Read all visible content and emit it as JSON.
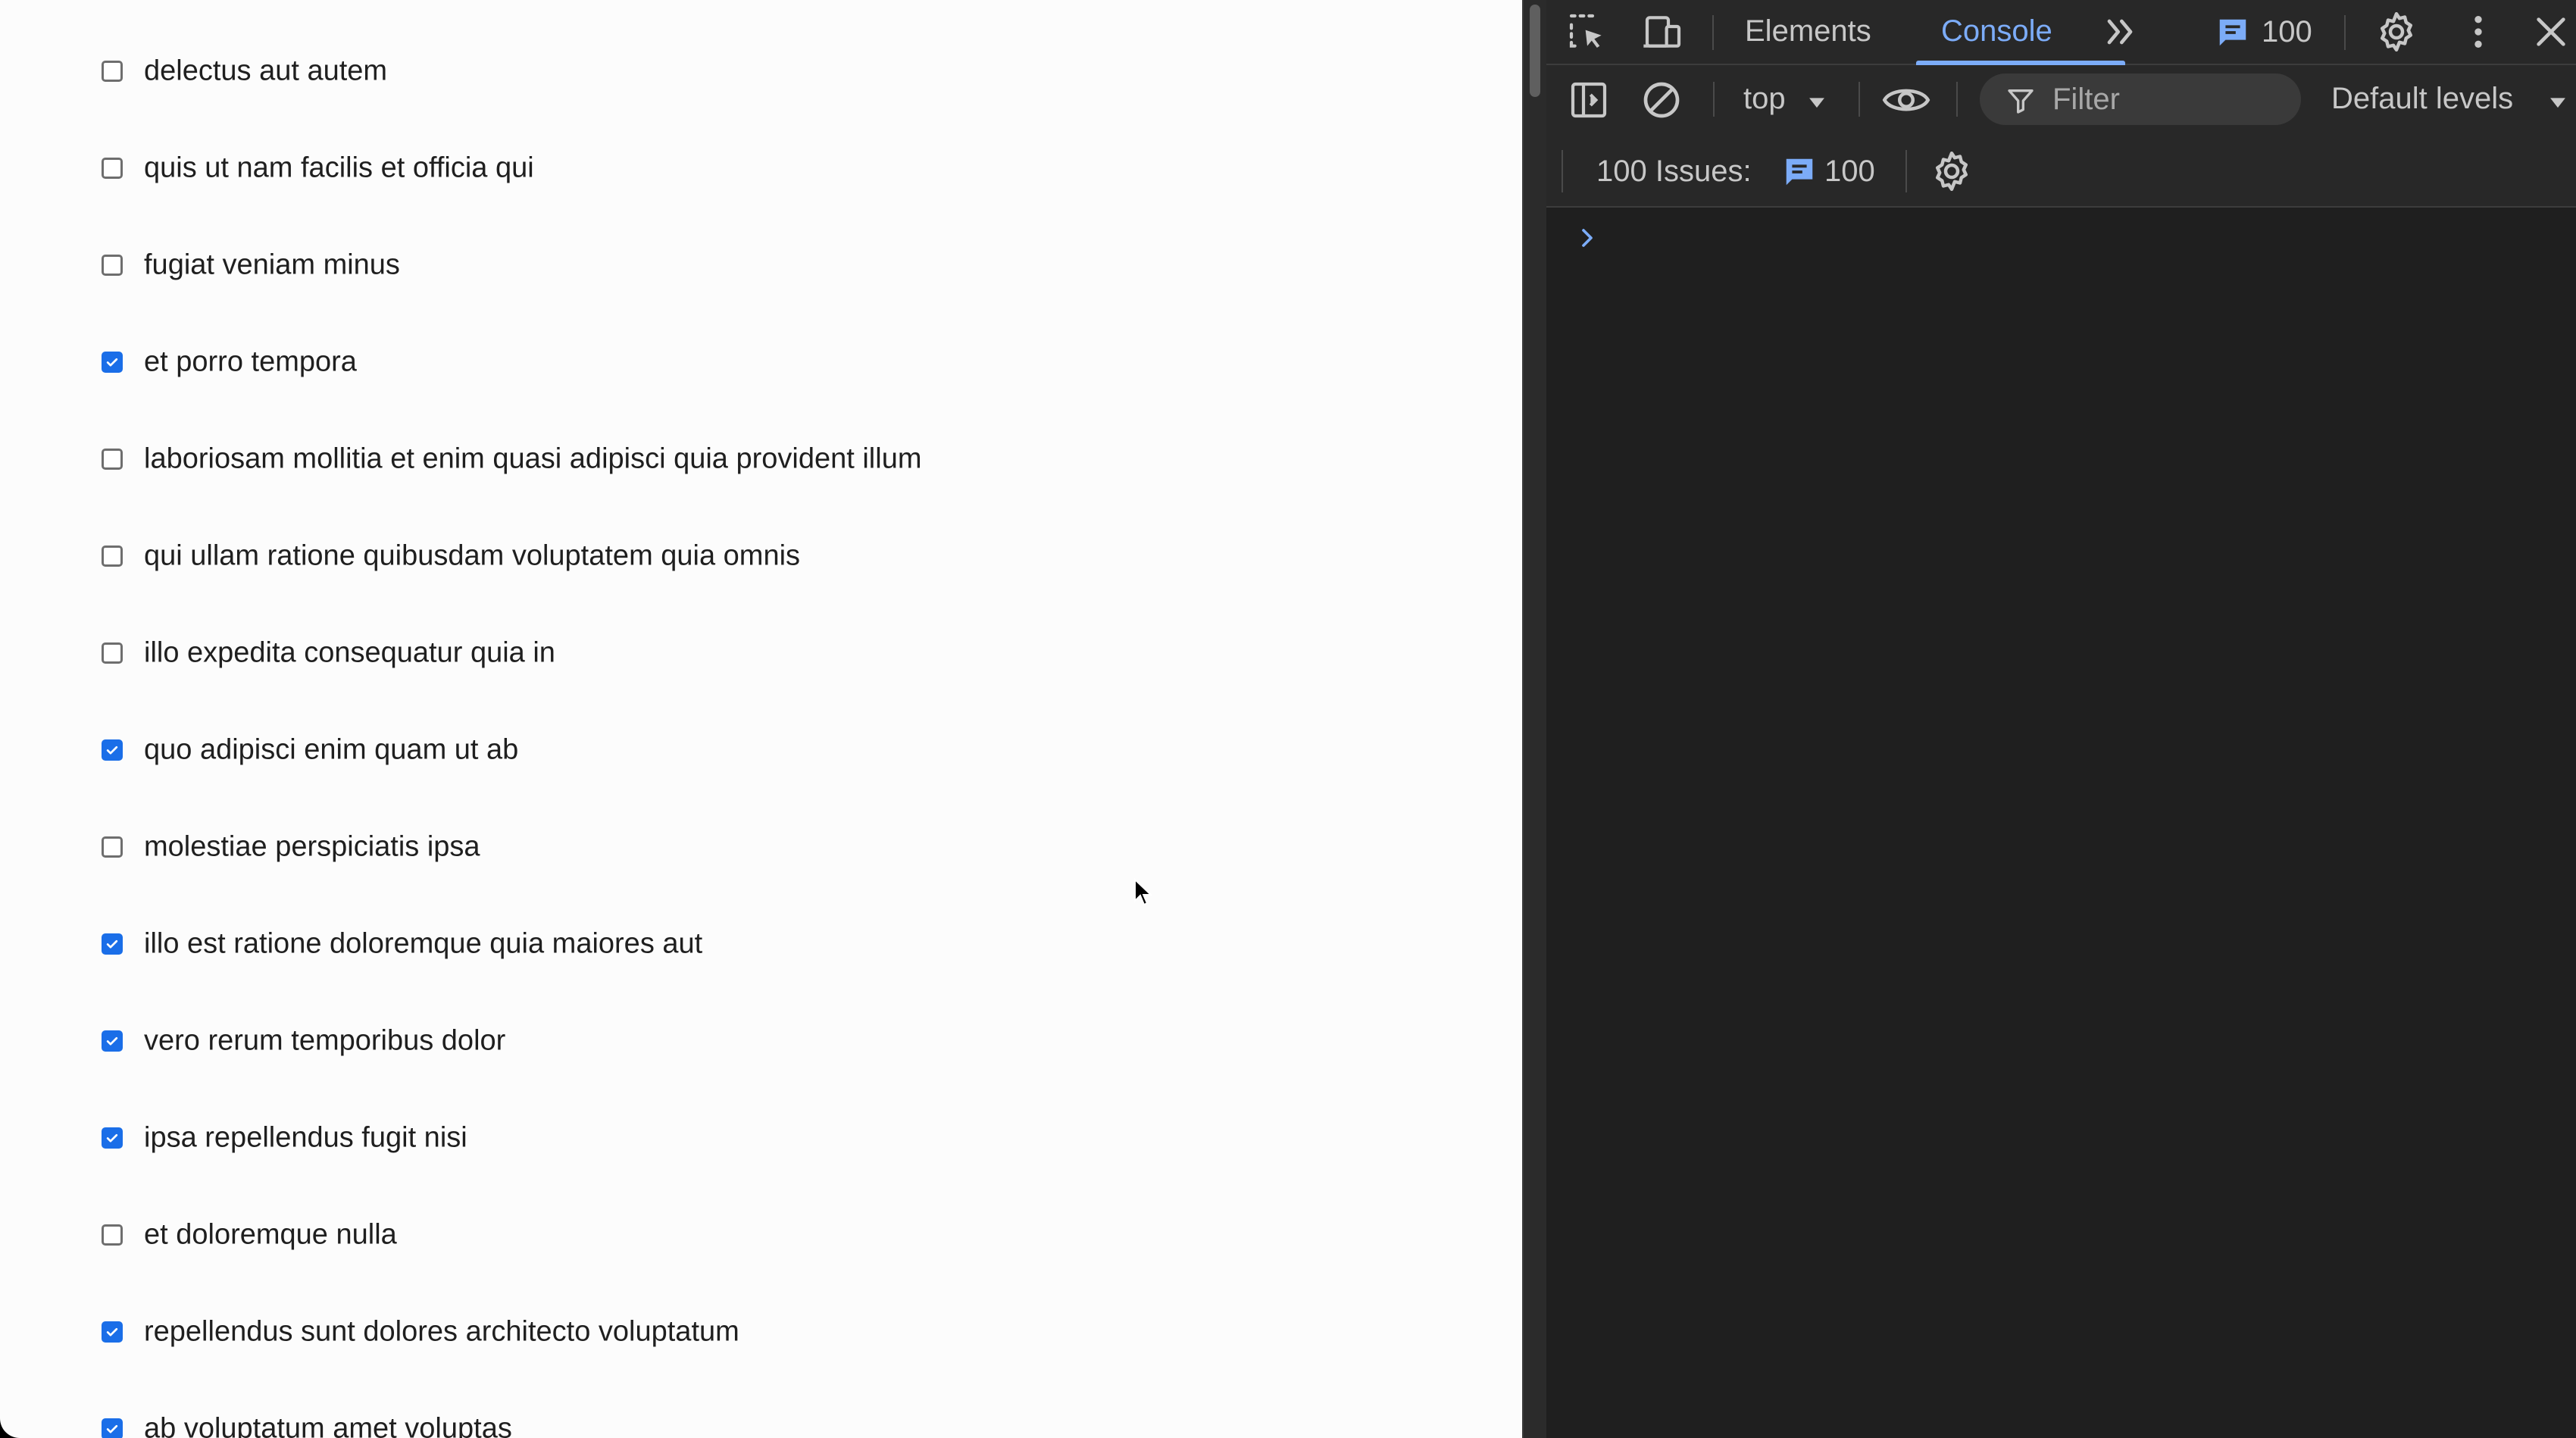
{
  "todos": [
    {
      "text": "delectus aut autem",
      "checked": false
    },
    {
      "text": "quis ut nam facilis et officia qui",
      "checked": false
    },
    {
      "text": "fugiat veniam minus",
      "checked": false
    },
    {
      "text": "et porro tempora",
      "checked": true
    },
    {
      "text": "laboriosam mollitia et enim quasi adipisci quia provident illum",
      "checked": false
    },
    {
      "text": "qui ullam ratione quibusdam voluptatem quia omnis",
      "checked": false
    },
    {
      "text": "illo expedita consequatur quia in",
      "checked": false
    },
    {
      "text": "quo adipisci enim quam ut ab",
      "checked": true
    },
    {
      "text": "molestiae perspiciatis ipsa",
      "checked": false
    },
    {
      "text": "illo est ratione doloremque quia maiores aut",
      "checked": true
    },
    {
      "text": "vero rerum temporibus dolor",
      "checked": true
    },
    {
      "text": "ipsa repellendus fugit nisi",
      "checked": true
    },
    {
      "text": "et doloremque nulla",
      "checked": false
    },
    {
      "text": "repellendus sunt dolores architecto voluptatum",
      "checked": true
    },
    {
      "text": "ab voluptatum amet voluptas",
      "checked": true
    }
  ],
  "devtools": {
    "tabs": {
      "elements": "Elements",
      "console": "Console"
    },
    "messages_count": "100",
    "toolbar": {
      "context": "top",
      "filter_placeholder": "Filter",
      "levels": "Default levels"
    },
    "issues": {
      "label": "100 Issues:",
      "count": "100"
    }
  },
  "colors": {
    "accent": "#7cacf8",
    "checkbox": "#1a6ee8",
    "devtools_bg": "#1f1f1f"
  }
}
